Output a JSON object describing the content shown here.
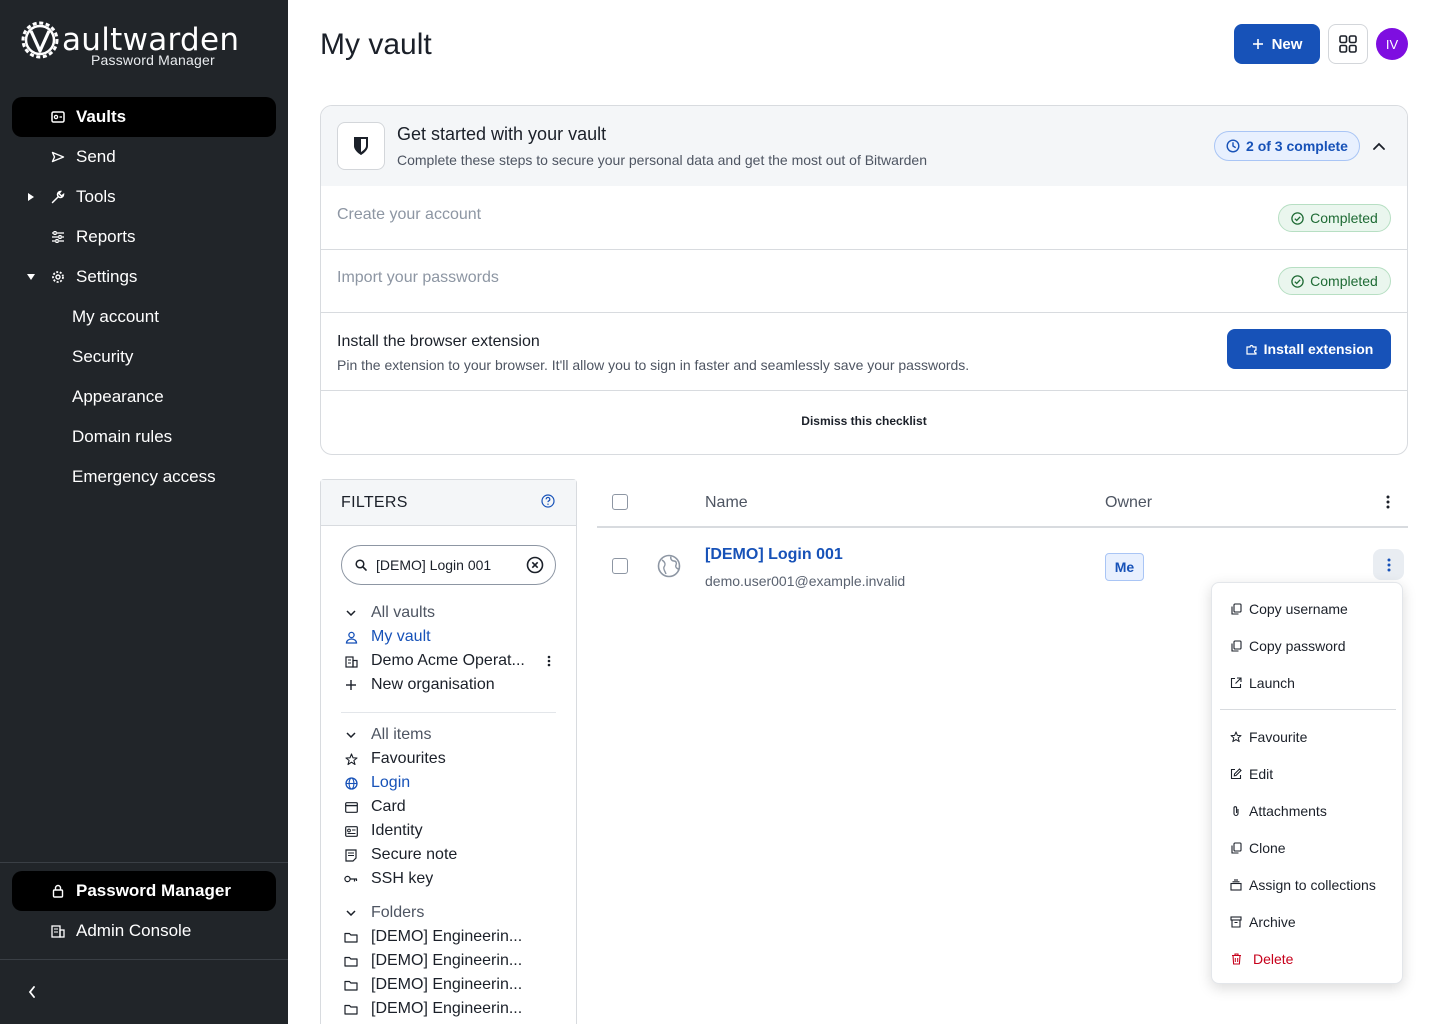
{
  "app": {
    "logo_text_bold": "V",
    "logo_text": "aultwarden",
    "logo_subtitle": "Password Manager"
  },
  "sidebar": {
    "items": [
      {
        "label": "Vaults",
        "icon": "vault-icon"
      },
      {
        "label": "Send",
        "icon": "send-icon"
      },
      {
        "label": "Tools",
        "icon": "wrench-icon"
      },
      {
        "label": "Reports",
        "icon": "sliders-icon"
      },
      {
        "label": "Settings",
        "icon": "gear-icon"
      }
    ],
    "settings_sub": [
      "My account",
      "Security",
      "Appearance",
      "Domain rules",
      "Emergency access"
    ],
    "footer": [
      {
        "label": "Password Manager",
        "icon": "lock-icon"
      },
      {
        "label": "Admin Console",
        "icon": "building-icon"
      }
    ]
  },
  "header": {
    "title": "My vault",
    "new_label": "New",
    "avatar_initials": "IV",
    "avatar_color": "#7e0ee0"
  },
  "checklist": {
    "title": "Get started with your vault",
    "subtitle": "Complete these steps to secure your personal data and get the most out of Bitwarden",
    "progress": "2 of 3 complete",
    "steps": [
      {
        "label": "Create your account",
        "status": "Completed"
      },
      {
        "label": "Import your passwords",
        "status": "Completed"
      }
    ],
    "extension": {
      "title": "Install the browser extension",
      "desc": "Pin the extension to your browser. It'll allow you to sign in faster and seamlessly save your passwords.",
      "button": "Install extension"
    },
    "dismiss": "Dismiss this checklist"
  },
  "filters": {
    "title": "FILTERS",
    "search_value": "[DEMO] Login 001",
    "vaults": {
      "head": "All vaults",
      "items": [
        "My vault",
        "Demo Acme Operat...",
        "New organisation"
      ]
    },
    "types": {
      "head": "All items",
      "items": [
        "Favourites",
        "Login",
        "Card",
        "Identity",
        "Secure note",
        "SSH key"
      ]
    },
    "folders": {
      "head": "Folders",
      "items": [
        "[DEMO] Engineerin...",
        "[DEMO] Engineerin...",
        "[DEMO] Engineerin...",
        "[DEMO] Engineerin..."
      ]
    }
  },
  "table": {
    "columns": [
      "Name",
      "Owner"
    ],
    "rows": [
      {
        "name": "[DEMO] Login 001",
        "username": "demo.user001@example.invalid",
        "owner": "Me"
      }
    ]
  },
  "context_menu": {
    "items": [
      "Copy username",
      "Copy password",
      "Launch",
      "Favourite",
      "Edit",
      "Attachments",
      "Clone",
      "Assign to collections",
      "Archive",
      "Delete"
    ]
  },
  "colors": {
    "primary": "#1752b8",
    "sidebar_bg": "#212529",
    "success": "#1f6b35",
    "danger": "#c7001b"
  }
}
